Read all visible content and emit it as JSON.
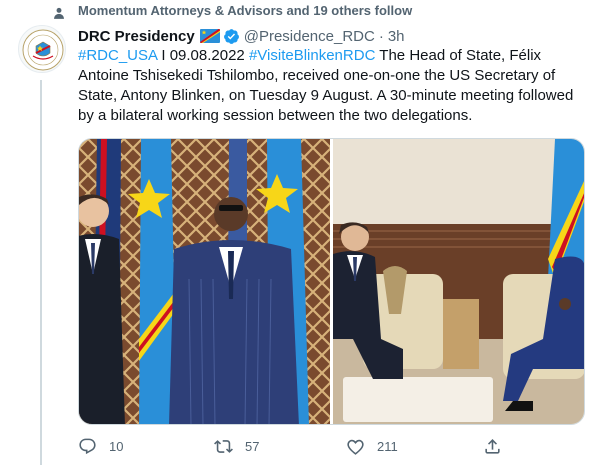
{
  "social_context": {
    "icon": "person-icon",
    "text": "Momentum Attorneys & Advisors and 19 others follow"
  },
  "author": {
    "name": "DRC Presidency",
    "flag_badge": "drc-flag-icon",
    "verified_badge": "verified-icon",
    "handle": "@Presidence_RDC",
    "separator": "·",
    "time": "3h"
  },
  "tweet": {
    "hashtag1": "#RDC_USA",
    "text1": " I 09.08.2022 ",
    "hashtag2": "#VisiteBlinkenRDC",
    "text2": " The Head of State, Félix Antoine Tshisekedi Tshilombo, received one-on-one the US Secretary of State, Antony Blinken, on Tuesday 9 August. A 30-minute meeting followed by a bilateral working session between the two delegations."
  },
  "actions": {
    "reply_count": "10",
    "retweet_count": "57",
    "like_count": "211"
  },
  "colors": {
    "accent": "#1d9bf0",
    "muted": "#536471",
    "flag_blue": "#2a8fd8",
    "flag_yellow": "#f7d618",
    "flag_red": "#ce1021"
  }
}
